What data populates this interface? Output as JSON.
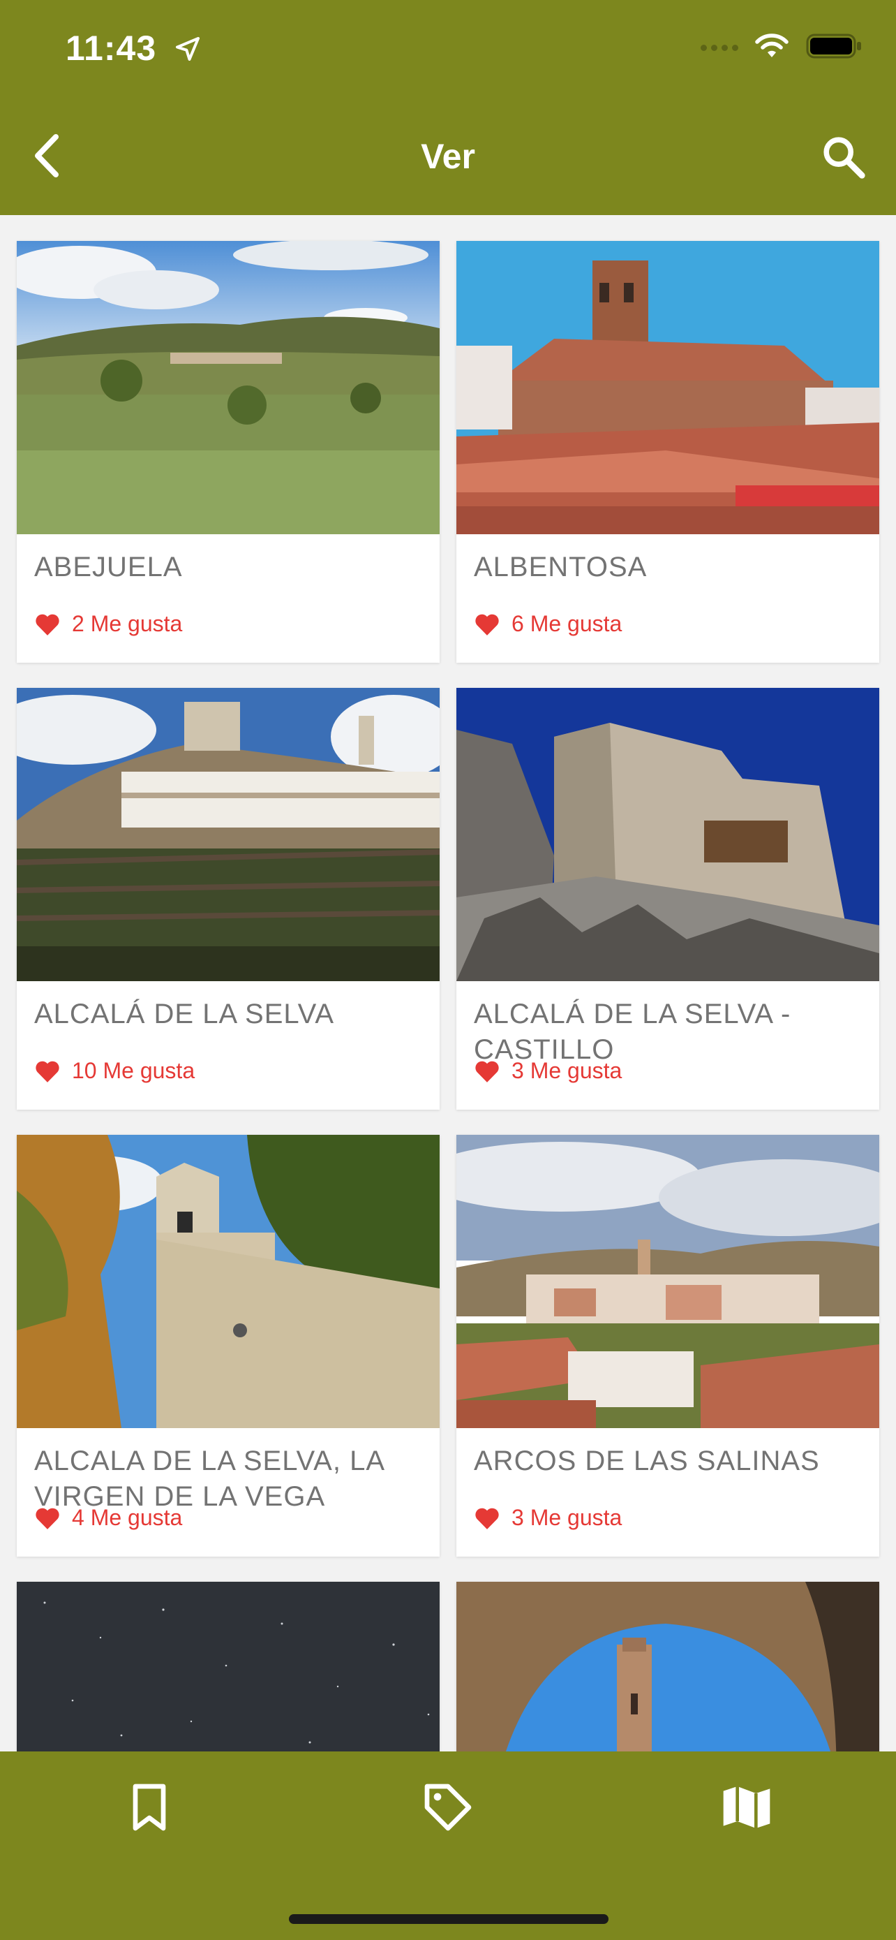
{
  "status_bar": {
    "time": "11:43"
  },
  "nav": {
    "title": "Ver"
  },
  "cards": [
    {
      "title": "ABEJUELA",
      "likes": "2 Me gusta",
      "photo": "landscape-village-hills"
    },
    {
      "title": "ALBENTOSA",
      "likes": "6 Me gusta",
      "photo": "church-tower-rooftops"
    },
    {
      "title": "ALCALÁ DE LA SELVA",
      "likes": "10 Me gusta",
      "photo": "hill-village-castle"
    },
    {
      "title": "ALCALÁ DE LA SELVA - CASTILLO",
      "likes": "3 Me gusta",
      "photo": "castle-on-rock"
    },
    {
      "title": "ALCALA DE LA SELVA, LA VIRGEN DE LA VEGA",
      "likes": "4 Me gusta",
      "photo": "bell-tower-chapel"
    },
    {
      "title": "ARCOS DE LAS SALINAS",
      "likes": "3 Me gusta",
      "photo": "town-panorama"
    },
    {
      "title": "",
      "likes": "",
      "photo": "starry-night-sky"
    },
    {
      "title": "",
      "likes": "",
      "photo": "tower-through-arch"
    }
  ],
  "colors": {
    "brand": "#7d871e",
    "like": "#e53935",
    "title_text": "#737373"
  },
  "tabs": [
    {
      "icon": "bookmark-icon"
    },
    {
      "icon": "tag-icon"
    },
    {
      "icon": "map-icon"
    }
  ]
}
